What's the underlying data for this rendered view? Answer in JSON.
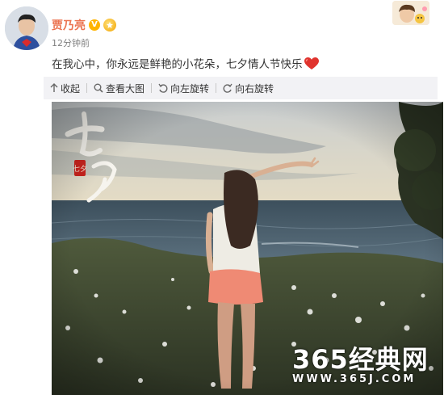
{
  "post": {
    "author": "贾乃亮",
    "verified_badge": "V",
    "timestamp": "12分钟前",
    "text": "在我心中，你永远是鲜艳的小花朵，七夕情人节快乐",
    "emoji_icon": "heart-icon",
    "accent_color": "#eb7350"
  },
  "toolbar": {
    "items": [
      {
        "label": "收起",
        "icon": "collapse-arrow-icon"
      },
      {
        "label": "查看大图",
        "icon": "magnify-icon"
      },
      {
        "label": "向左旋转",
        "icon": "rotate-left-icon"
      },
      {
        "label": "向右旋转",
        "icon": "rotate-right-icon"
      }
    ]
  },
  "image": {
    "calligraphy": "七夕",
    "seal": "七夕"
  },
  "watermark": {
    "brand": "365经典网",
    "url": "WWW.365J.COM"
  }
}
